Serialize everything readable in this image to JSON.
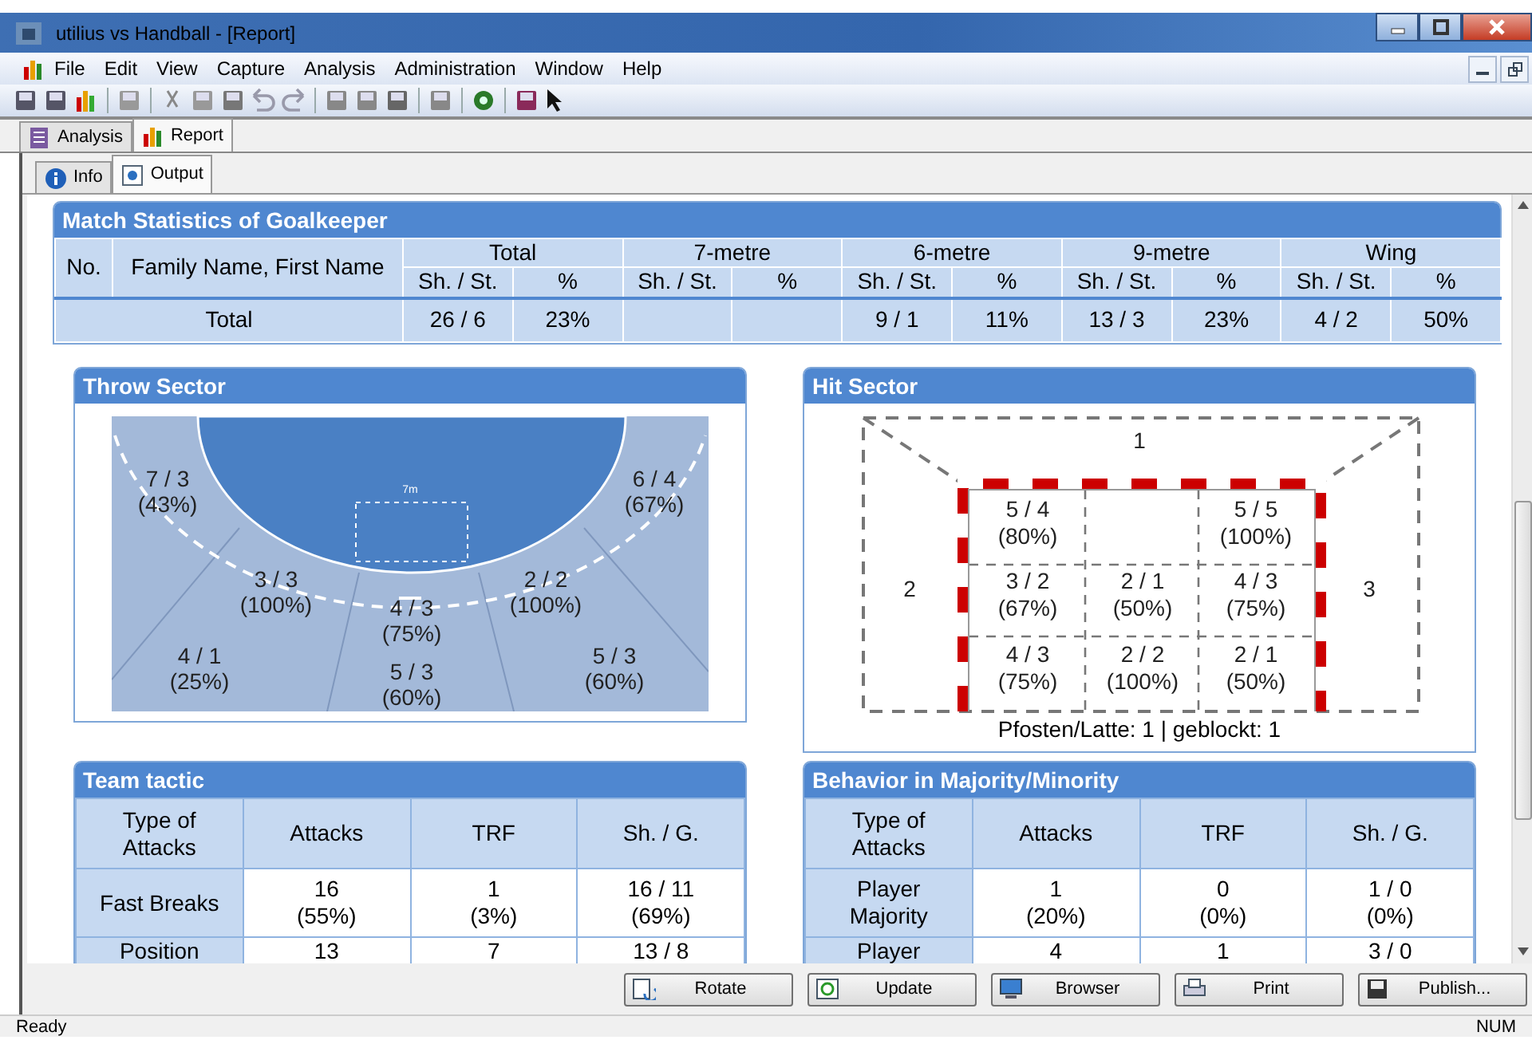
{
  "window": {
    "title": "utilius vs Handball - [Report]"
  },
  "menu": [
    "File",
    "Edit",
    "View",
    "Capture",
    "Analysis",
    "Administration",
    "Window",
    "Help"
  ],
  "doc_tabs": [
    {
      "label": "Analysis",
      "selected": false
    },
    {
      "label": "Report",
      "selected": true
    }
  ],
  "sub_tabs": [
    {
      "label": "Info",
      "selected": false
    },
    {
      "label": "Output",
      "selected": true
    }
  ],
  "goalkeeper_stats": {
    "title": "Match Statistics of Goalkeeper",
    "no_header": "No.",
    "name_header": "Family Name, First Name",
    "groups": [
      {
        "label": "Total",
        "columns": [
          "Sh. / St.",
          "%"
        ]
      },
      {
        "label": "7-metre",
        "columns": [
          "Sh. / St.",
          "%"
        ]
      },
      {
        "label": "6-metre",
        "columns": [
          "Sh. / St.",
          "%"
        ]
      },
      {
        "label": "9-metre",
        "columns": [
          "Sh. / St.",
          "%"
        ]
      },
      {
        "label": "Wing",
        "columns": [
          "Sh. / St.",
          "%"
        ]
      }
    ],
    "total_row": {
      "label": "Total",
      "cells": [
        "26 / 6",
        "23%",
        null,
        null,
        "9 / 1",
        "11%",
        "13 / 3",
        "23%",
        "4 / 2",
        "50%"
      ]
    }
  },
  "throw_sector": {
    "title": "Throw Sector",
    "goal_area_label": "7m",
    "sectors": [
      {
        "value": "7 / 3",
        "percent": "(43%)"
      },
      {
        "value": "6 / 4",
        "percent": "(67%)"
      },
      {
        "value": "3 / 3",
        "percent": "(100%)"
      },
      {
        "value": "2 / 2",
        "percent": "(100%)"
      },
      {
        "value": "4 / 3",
        "percent": "(75%)"
      },
      {
        "value": "4 / 1",
        "percent": "(25%)"
      },
      {
        "value": "5 / 3",
        "percent": "(60%)"
      },
      {
        "value": "5 / 3",
        "percent": "(60%)"
      }
    ]
  },
  "hit_sector": {
    "title": "Hit Sector",
    "zones": [
      "1",
      "2",
      "3"
    ],
    "cells": [
      {
        "value": "5 / 4",
        "percent": "(80%)"
      },
      null,
      {
        "value": "5 / 5",
        "percent": "(100%)"
      },
      {
        "value": "3 / 2",
        "percent": "(67%)"
      },
      {
        "value": "2 / 1",
        "percent": "(50%)"
      },
      {
        "value": "4 / 3",
        "percent": "(75%)"
      },
      {
        "value": "4 / 3",
        "percent": "(75%)"
      },
      {
        "value": "2 / 2",
        "percent": "(100%)"
      },
      {
        "value": "2 / 1",
        "percent": "(50%)"
      }
    ],
    "footer": "Pfosten/Latte: 1 | geblockt: 1"
  },
  "team_tactic": {
    "title": "Team tactic",
    "columns": [
      "Type of Attacks",
      "Attacks",
      "TRF",
      "Sh. / G."
    ],
    "rows": [
      {
        "cells": [
          [
            "Fast Breaks"
          ],
          [
            "16",
            "(55%)"
          ],
          [
            "1",
            "(3%)"
          ],
          [
            "16 / 11",
            "(69%)"
          ]
        ]
      },
      {
        "cells": [
          [
            "Position"
          ],
          [
            "13"
          ],
          [
            "7"
          ],
          [
            "13 / 8"
          ]
        ]
      }
    ]
  },
  "behavior": {
    "title": "Behavior in Majority/Minority",
    "columns": [
      "Type of Attacks",
      "Attacks",
      "TRF",
      "Sh. / G."
    ],
    "rows": [
      {
        "cells": [
          [
            "Player Majority"
          ],
          [
            "1",
            "(20%)"
          ],
          [
            "0",
            "(0%)"
          ],
          [
            "1 / 0",
            "(0%)"
          ]
        ]
      },
      {
        "cells": [
          [
            "Player"
          ],
          [
            "4"
          ],
          [
            "1"
          ],
          [
            "3 / 0"
          ]
        ]
      }
    ]
  },
  "buttons": [
    "Rotate",
    "Update",
    "Browser",
    "Print",
    "Publish..."
  ],
  "status_bar": {
    "text": "Ready",
    "indicator": "NUM"
  }
}
